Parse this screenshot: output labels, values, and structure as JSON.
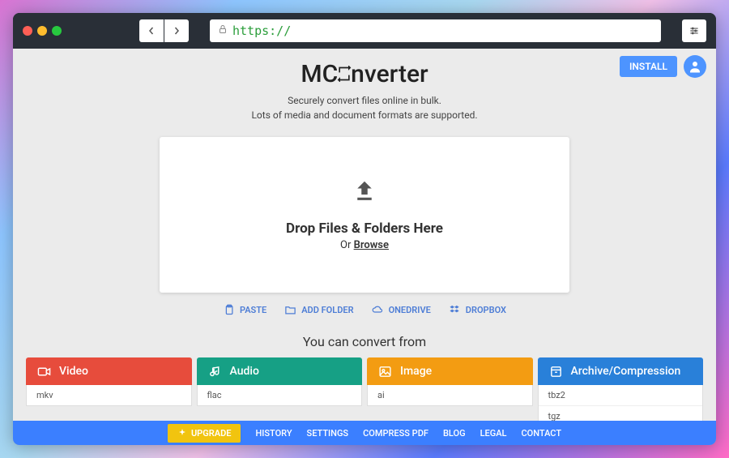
{
  "browser": {
    "url_scheme": "https://"
  },
  "topbar": {
    "install_label": "INSTALL"
  },
  "hero": {
    "logo_pre": "MC",
    "logo_post": "nverter",
    "subtitle_l1": "Securely convert files online in bulk.",
    "subtitle_l2": "Lots of media and document formats are supported."
  },
  "dropzone": {
    "title": "Drop Files & Folders Here",
    "or": "Or ",
    "browse": "Browse"
  },
  "actions": {
    "paste": "PASTE",
    "add_folder": "ADD FOLDER",
    "onedrive": "ONEDRIVE",
    "dropbox": "DROPBOX"
  },
  "convert_label": "You can convert from",
  "categories": {
    "video": {
      "label": "Video",
      "items": [
        "mkv"
      ]
    },
    "audio": {
      "label": "Audio",
      "items": [
        "flac"
      ]
    },
    "image": {
      "label": "Image",
      "items": [
        "ai"
      ]
    },
    "archive": {
      "label": "Archive/Compression",
      "items": [
        "tbz2",
        "tgz"
      ]
    }
  },
  "footer": {
    "upgrade": "UPGRADE",
    "links": [
      "HISTORY",
      "SETTINGS",
      "COMPRESS PDF",
      "BLOG",
      "LEGAL",
      "CONTACT"
    ]
  }
}
